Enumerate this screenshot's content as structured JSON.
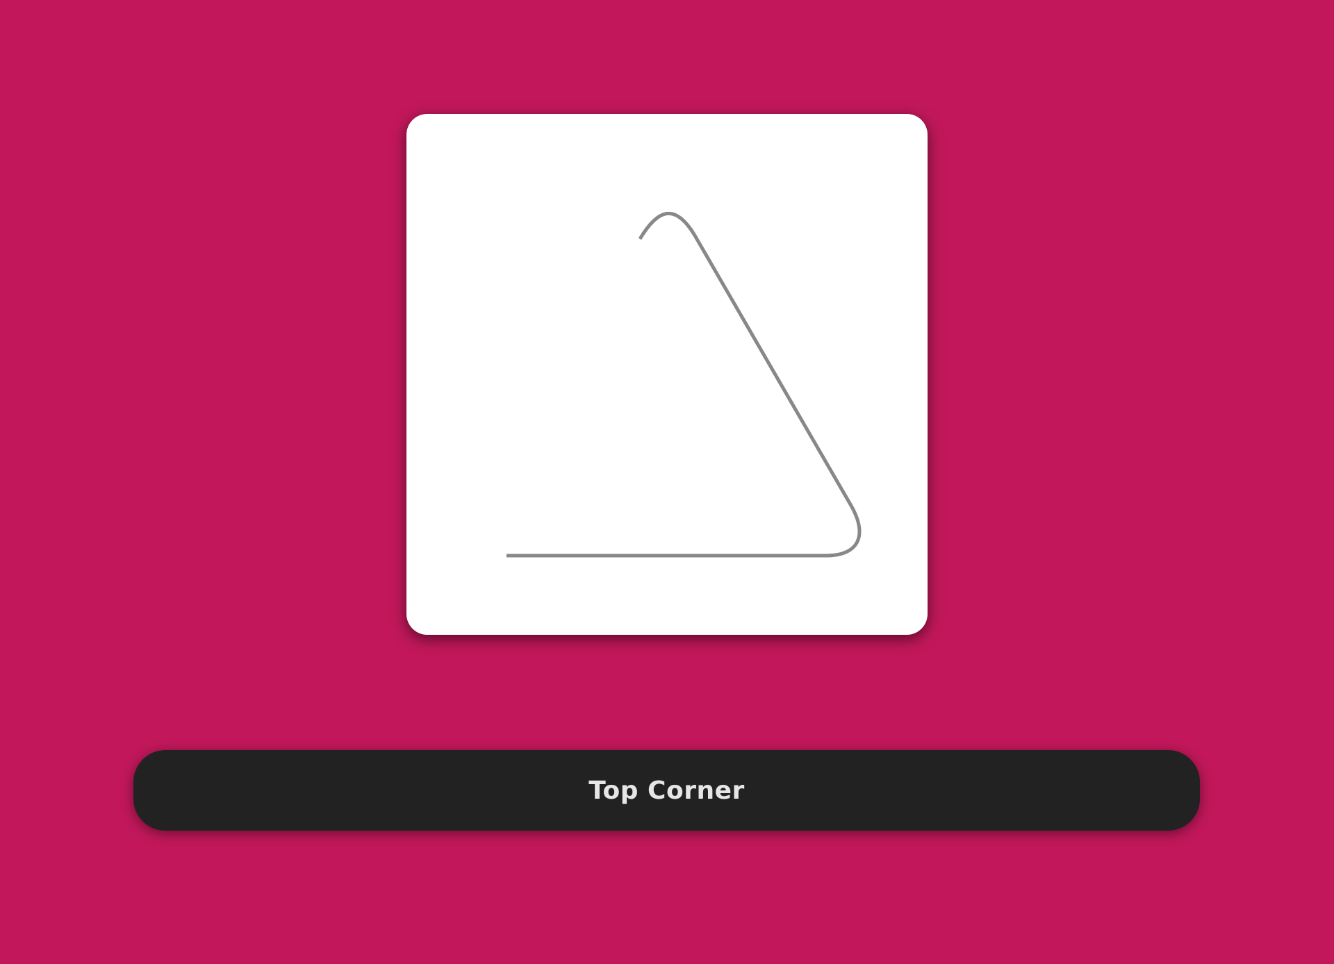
{
  "theme": {
    "background_color": "#c2185b",
    "card_color": "#ffffff",
    "stroke_color": "#888888",
    "button_color": "#222222",
    "button_text_color": "#e6e6e6"
  },
  "drawing": {
    "shape": "open-rounded-triangle-outline",
    "description_icon": "triangle-stroke"
  },
  "action_button": {
    "label": "Top Corner"
  }
}
